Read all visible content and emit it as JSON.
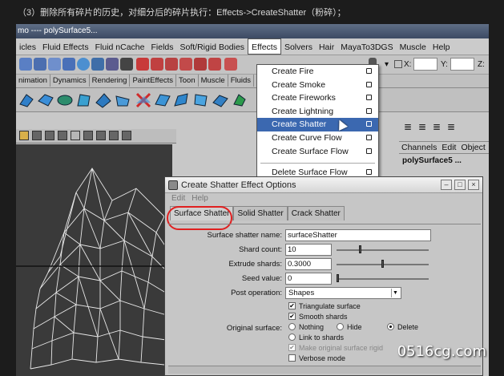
{
  "caption": "（3）删除所有碎片的历史，对细分后的碎片执行：Effects->CreateShatter（粉碎）；",
  "window_title": "mo ---- polySurface5...",
  "menubar": [
    "icles",
    "Fluid Effects",
    "Fluid nCache",
    "Fields",
    "Soft/Rigid Bodies",
    "Effects",
    "Solvers",
    "Hair",
    "MayaTo3DGS",
    "Muscle",
    "Help"
  ],
  "active_menu": "Effects",
  "shelf_tabs": [
    "nimation",
    "Dynamics",
    "Rendering",
    "PaintEffects",
    "Toon",
    "Muscle",
    "Fluids"
  ],
  "coords": {
    "x_label": "X:",
    "y_label": "Y:",
    "z_label": "Z:"
  },
  "effects_menu": {
    "items": [
      {
        "label": "Create Fire",
        "highlighted": false
      },
      {
        "label": "Create Smoke",
        "highlighted": false
      },
      {
        "label": "Create Fireworks",
        "highlighted": false
      },
      {
        "label": "Create Lightning",
        "highlighted": false
      },
      {
        "label": "Create Shatter",
        "highlighted": true
      },
      {
        "label": "Create Curve Flow",
        "highlighted": false
      },
      {
        "label": "Create Surface Flow",
        "highlighted": false
      }
    ],
    "after_separator": {
      "label": "Delete Surface Flow"
    }
  },
  "channel_box": {
    "tabs": [
      "Channels",
      "Edit",
      "Object"
    ],
    "object_name": "polySurface5 ..."
  },
  "dialog": {
    "title": "Create Shatter Effect Options",
    "menu": [
      "Edit",
      "Help"
    ],
    "tabs": [
      "Surface Shatter",
      "Solid Shatter",
      "Crack Shatter"
    ],
    "selected_tab": "Surface Shatter",
    "fields": {
      "name_label": "Surface shatter name:",
      "name_value": "surfaceShatter",
      "shard_label": "Shard count:",
      "shard_value": "10",
      "shard_level": 0.25,
      "extrude_label": "Extrude shards:",
      "extrude_value": "0.3000",
      "extrude_level": 0.5,
      "seed_label": "Seed value:",
      "seed_value": "0",
      "seed_level": 0.0,
      "post_label": "Post operation:",
      "post_value": "Shapes",
      "triangulate_label": "Triangulate surface",
      "smooth_label": "Smooth shards",
      "original_label": "Original surface:",
      "opt_nothing": "Nothing",
      "opt_hide": "Hide",
      "opt_delete": "Delete",
      "opt_link": "Link to shards",
      "opt_rigid": "Make original surface rigid",
      "opt_verbose": "Verbose mode"
    }
  },
  "watermark": "0516cg.com"
}
